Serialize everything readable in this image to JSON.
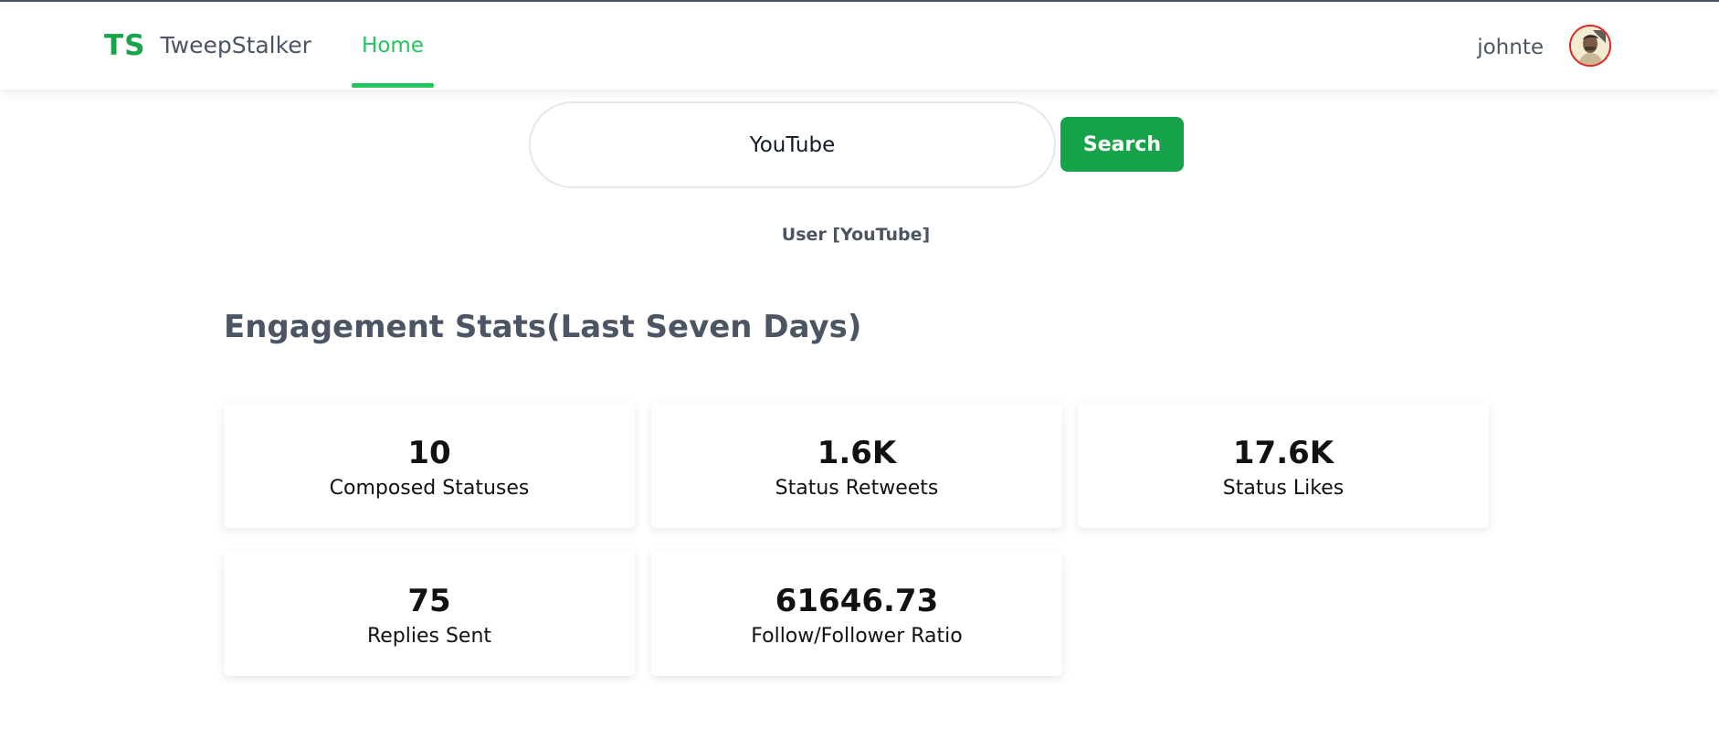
{
  "brand": {
    "logo": "TS",
    "name": "TweepStalker"
  },
  "nav": {
    "home_label": "Home"
  },
  "user": {
    "name": "johnte"
  },
  "search": {
    "value": "YouTube",
    "button_label": "Search"
  },
  "result": {
    "user_label": "User [YouTube]"
  },
  "stats": {
    "title": "Engagement Stats(Last Seven Days)",
    "cards": [
      {
        "value": "10",
        "label": "Composed Statuses"
      },
      {
        "value": "1.6K",
        "label": "Status Retweets"
      },
      {
        "value": "17.6K",
        "label": "Status Likes"
      },
      {
        "value": "75",
        "label": "Replies Sent"
      },
      {
        "value": "61646.73",
        "label": "Follow/Follower Ratio"
      }
    ]
  },
  "colors": {
    "accent": "#16a34a",
    "accent_light": "#22c55e",
    "text_muted": "#4b5563"
  }
}
